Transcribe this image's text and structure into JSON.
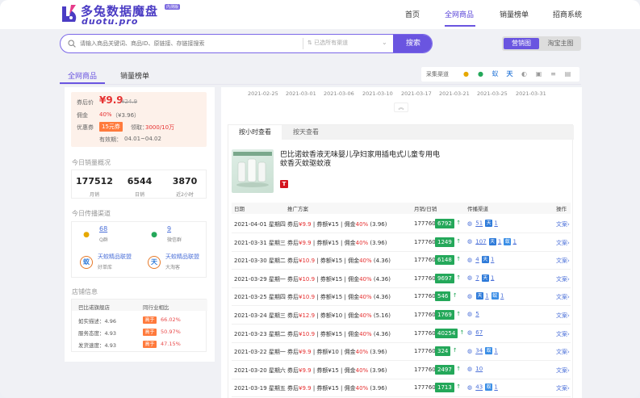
{
  "header": {
    "logo_cn": "多兔数据魔盘",
    "logo_en": "duotu.pro",
    "logo_badge": "内测版",
    "nav": [
      "首页",
      "全网商品",
      "销量榜单",
      "招商系统"
    ],
    "nav_active": 1
  },
  "search": {
    "placeholder": "请输入商品关键词、商品ID、原链接、存链接搜索",
    "channel": "已选所有渠道",
    "button": "搜索"
  },
  "view_toggle": {
    "on": "营销图",
    "off": "淘宝主图"
  },
  "tabs": [
    "全网商品",
    "销量榜单"
  ],
  "channel_bar": {
    "label": "采集渠道"
  },
  "left": {
    "price_label": "券后价",
    "price": "¥9.9",
    "price_old": "¥24.9",
    "commission_label": "佣金",
    "commission_pct": "40%",
    "commission_amt": "（¥3.96）",
    "coupon_label": "优惠券",
    "coupon_badge": "15元券",
    "coupon_claimed_label": "领取：",
    "coupon_claimed": "3000/10万",
    "valid_label": "有效期：",
    "valid": "04.01~04.02",
    "sales_title": "今日销量概况",
    "stats": [
      {
        "num": "177512",
        "label": "月销"
      },
      {
        "num": "6544",
        "label": "日销"
      },
      {
        "num": "3870",
        "label": "近2小时"
      }
    ],
    "channel_title": "今日传播渠道",
    "channels": {
      "qq_num": "68",
      "qq_label": "Q群",
      "wx_num": "9",
      "wx_label": "微信群",
      "alliance1": "天蛟精品联盟",
      "alliance1_sub": "好单库",
      "alliance2": "天蛟精品联盟",
      "alliance2_sub": "大淘客"
    },
    "shop_title": "店铺信息",
    "shop": {
      "name": "巴比诺旗舰店",
      "compare": "同行业相比",
      "rows": [
        {
          "label": "如实描述：4.96",
          "badge": "高于",
          "pct": "66.02%"
        },
        {
          "label": "服务态度：4.93",
          "badge": "高于",
          "pct": "50.97%"
        },
        {
          "label": "发货速度：4.93",
          "badge": "高于",
          "pct": "47.15%"
        }
      ]
    }
  },
  "right": {
    "dates": [
      "2021-02-25",
      "2021-03-01",
      "2021-03-06",
      "2021-03-10",
      "2021-03-17",
      "2021-03-21",
      "2021-03-25",
      "2021-03-31"
    ],
    "card_tabs": [
      "按小时查看",
      "按天查看"
    ],
    "product_title": "巴比诺蚊香液无味婴儿孕妇家用插电式儿童专用电蚊香灭蚊驱蚊液",
    "tmall_icon": "T",
    "table_headers": [
      "日期",
      "推广方案",
      "月销/日销",
      "传播渠道",
      "操作"
    ],
    "rows": [
      {
        "date": "2021-04-01 星期四",
        "after": "9.9",
        "coupon": "15",
        "comm": "40%",
        "amt": "(3.96)",
        "month": "177760",
        "day": "6792",
        "qq": "51",
        "b1": "天",
        "n1": "1",
        "b2": "",
        "n2": "",
        "op": "文案"
      },
      {
        "date": "2021-03-31 星期三",
        "after": "9.9",
        "coupon": "15",
        "comm": "40%",
        "amt": "(3.96)",
        "month": "177760",
        "day": "1249",
        "qq": "107",
        "b1": "天",
        "n1": "1",
        "b2": "蚁",
        "n2": "1",
        "op": "文案"
      },
      {
        "date": "2021-03-30 星期二",
        "after": "10.9",
        "coupon": "15",
        "comm": "40%",
        "amt": "(4.36)",
        "month": "177760",
        "day": "6148",
        "qq": "4",
        "b1": "天",
        "n1": "1",
        "b2": "",
        "n2": "",
        "op": "文案"
      },
      {
        "date": "2021-03-29 星期一",
        "after": "10.9",
        "coupon": "15",
        "comm": "40%",
        "amt": "(4.36)",
        "month": "177760",
        "day": "9697",
        "qq": "7",
        "b1": "天",
        "n1": "1",
        "b2": "",
        "n2": "",
        "op": "文案"
      },
      {
        "date": "2021-03-25 星期四",
        "after": "10.9",
        "coupon": "15",
        "comm": "40%",
        "amt": "(4.36)",
        "month": "177760",
        "day": "546",
        "qq": "",
        "b1": "天",
        "n1": "1",
        "b2": "蚁",
        "n2": "1",
        "op": "文案"
      },
      {
        "date": "2021-03-24 星期三",
        "after": "12.9",
        "coupon": "10",
        "comm": "40%",
        "amt": "(5.16)",
        "month": "177760",
        "day": "1769",
        "qq": "5",
        "b1": "",
        "n1": "",
        "b2": "",
        "n2": "",
        "op": "文案"
      },
      {
        "date": "2021-03-23 星期二",
        "after": "10.9",
        "coupon": "15",
        "comm": "40%",
        "amt": "(4.36)",
        "month": "177760",
        "day": "40254",
        "qq": "67",
        "b1": "",
        "n1": "",
        "b2": "",
        "n2": "",
        "op": "文案"
      },
      {
        "date": "2021-03-22 星期一",
        "after": "9.9",
        "coupon": "10",
        "comm": "40%",
        "amt": "(3.96)",
        "month": "177760",
        "day": "324",
        "qq": "34",
        "b1": "蚁",
        "n1": "1",
        "b2": "",
        "n2": "",
        "op": "文案"
      },
      {
        "date": "2021-03-20 星期六",
        "after": "9.9",
        "coupon": "15",
        "comm": "40%",
        "amt": "(3.96)",
        "month": "177760",
        "day": "2497",
        "qq": "10",
        "b1": "",
        "n1": "",
        "b2": "",
        "n2": "",
        "op": "文案"
      },
      {
        "date": "2021-03-19 星期五",
        "after": "9.9",
        "coupon": "15",
        "comm": "40%",
        "amt": "(3.96)",
        "month": "177760",
        "day": "1713",
        "qq": "43",
        "b1": "蚁",
        "n1": "1",
        "b2": "",
        "n2": "",
        "op": "文案"
      }
    ],
    "plan_labels": {
      "after": "券后",
      "coupon": "券额",
      "comm": "佣金",
      "currency": "¥"
    }
  },
  "colors": {
    "accent": "#6a55e0",
    "price": "#e63030",
    "badge_green": "#24a85a",
    "badge_orange": "#ff7a3c"
  }
}
